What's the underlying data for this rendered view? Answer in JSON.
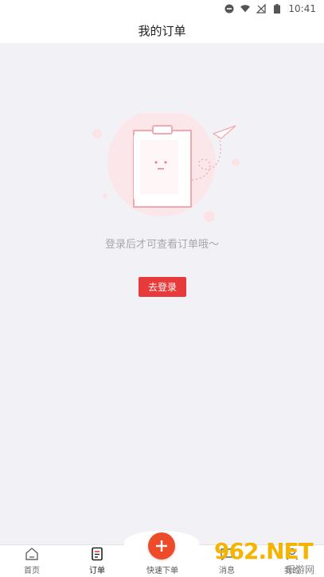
{
  "status_bar": {
    "time": "10:41"
  },
  "navbar": {
    "title": "我的订单"
  },
  "empty_state": {
    "message": "登录后才可查看订单哦～",
    "login_button": "去登录"
  },
  "tabbar": {
    "items": [
      {
        "label": "首页",
        "icon": "home-icon"
      },
      {
        "label": "订单",
        "icon": "order-icon",
        "active": true
      },
      {
        "label": "快速下单",
        "icon": "plus-icon"
      },
      {
        "label": "消息",
        "icon": "message-icon"
      },
      {
        "label": "我的",
        "icon": "user-icon"
      }
    ]
  },
  "watermark": {
    "brand": "962.NET",
    "sub": "乐游网"
  },
  "colors": {
    "accent": "#e83a3a",
    "add_button": "#ee4b2b",
    "background": "#f2f2f6"
  }
}
